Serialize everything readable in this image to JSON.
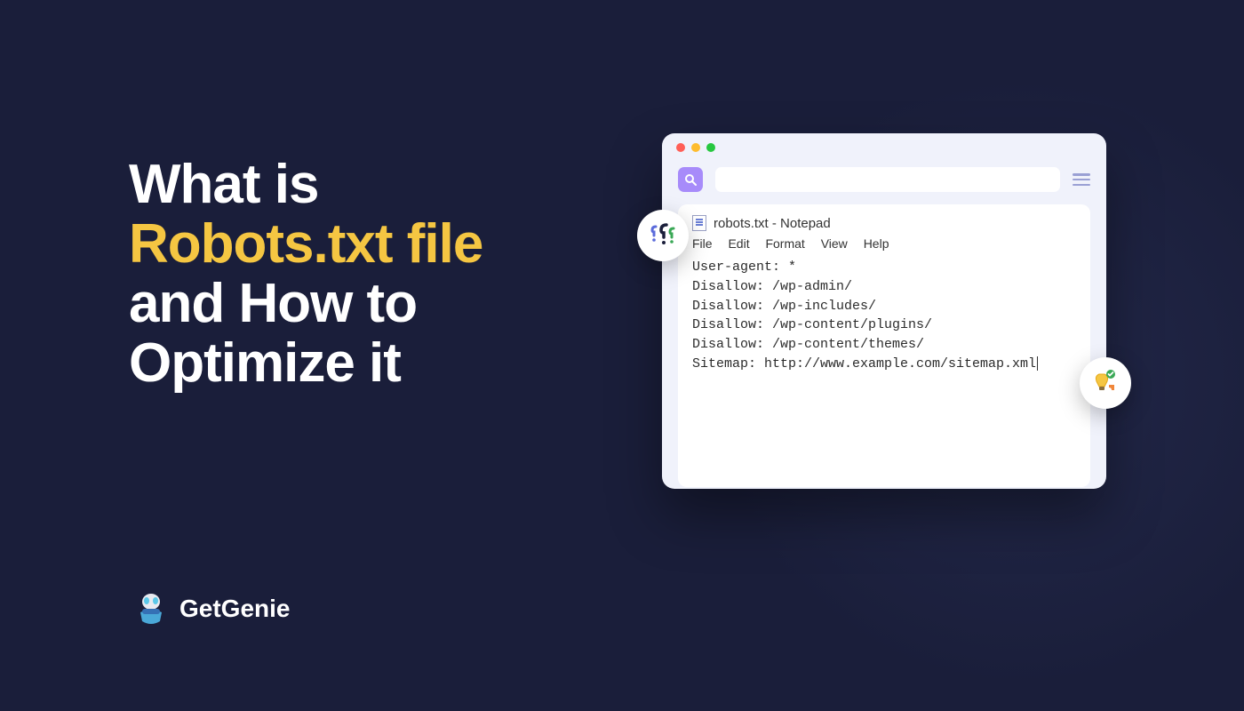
{
  "title": {
    "line1": "What is",
    "line2_highlight": "Robots.txt file",
    "line3": "and How to",
    "line4": "Optimize it"
  },
  "brand": {
    "name": "GetGenie"
  },
  "browser": {
    "notepad": {
      "title": "robots.txt - Notepad",
      "menu": [
        "File",
        "Edit",
        "Format",
        "View",
        "Help"
      ],
      "lines": [
        "User-agent: *",
        "Disallow: /wp-admin/",
        "Disallow: /wp-includes/",
        "Disallow: /wp-content/plugins/",
        "Disallow: /wp-content/themes/",
        "",
        "Sitemap: http://www.example.com/sitemap.xml"
      ]
    }
  },
  "colors": {
    "accent": "#f5c642",
    "bg": "#1a1e3a"
  }
}
